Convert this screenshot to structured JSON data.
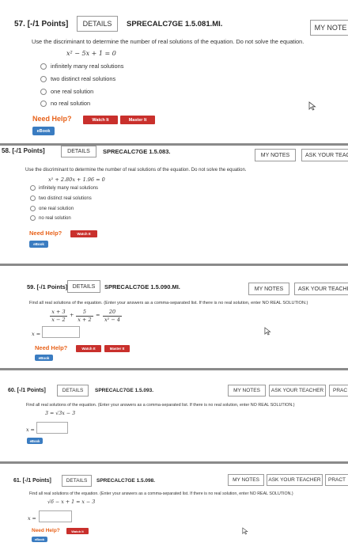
{
  "colors": {
    "need_help": "#e8621a",
    "watch": "#c9302c",
    "ebook": "#3a7cc1"
  },
  "problems": [
    {
      "header": "57. [-/1 Points]",
      "details": "DETAILS",
      "code": "SPRECALC7GE 1.5.081.MI.",
      "my_notes": "MY NOTE",
      "question": "Use the discriminant to determine the number of real solutions of the equation. Do not solve the equation.",
      "equation": "x² − 5x + 1 = 0",
      "options": [
        "infinitely many real solutions",
        "two distinct real solutions",
        "one real solution",
        "no real solution"
      ],
      "need_help": "Need Help?",
      "watch": "Watch It",
      "master": "Master It",
      "ebook": "eBook"
    },
    {
      "header": "58. [-/1 Points]",
      "details": "DETAILS",
      "code": "SPRECALC7GE 1.5.083.",
      "my_notes": "MY NOTES",
      "ask": "ASK YOUR TEACH",
      "question": "Use the discriminant to determine the number of real solutions of the equation. Do not solve the equation.",
      "equation": "x² + 2.80x + 1.96 = 0",
      "options": [
        "infinitely many real solutions",
        "two distinct real solutions",
        "one real solution",
        "no real solution"
      ],
      "need_help": "Need Help?",
      "watch": "Watch It",
      "ebook": "eBook"
    },
    {
      "header": "59. [-/1 Points]",
      "details": "DETAILS",
      "code": "SPRECALC7GE 1.5.090.MI.",
      "my_notes": "MY NOTES",
      "ask": "ASK YOUR TEACHER",
      "question": "Find all real solutions of the equation. (Enter your answers as a comma-separated list. If there is no real solution, enter NO REAL SOLUTION.)",
      "eq_parts": [
        "x + 3",
        "x − 2",
        "5",
        "x + 2",
        "20",
        "x² − 4",
        "+",
        "="
      ],
      "x_label": "x =",
      "need_help": "Need Help?",
      "watch": "Watch It",
      "master": "Master It",
      "ebook": "eBook"
    },
    {
      "header": "60. [-/1 Points]",
      "details": "DETAILS",
      "code": "SPRECALC7GE 1.5.093.",
      "my_notes": "MY NOTES",
      "ask": "ASK YOUR TEACHER",
      "prac": "PRAC",
      "question": "Find all real solutions of the equation. (Enter your answers as a comma-separated list. If there is no real solution, enter NO REAL SOLUTION.)",
      "equation": "3 = √3x − 3",
      "x_label": "x =",
      "ebook": "eBook"
    },
    {
      "header": "61. [-/1 Points]",
      "details": "DETAILS",
      "code": "SPRECALC7GE 1.5.098.",
      "my_notes": "MY NOTES",
      "ask": "ASK YOUR TEACHER",
      "prac": "PRACT",
      "question": "Find all real solutions of the equation. (Enter your answers as a comma-separated list. If there is no real solution, enter NO REAL SOLUTION.)",
      "equation": "√6 − x + 1 = x − 3",
      "x_label": "x =",
      "need_help": "Need Help?",
      "watch": "Watch It",
      "ebook": "eBook"
    }
  ]
}
